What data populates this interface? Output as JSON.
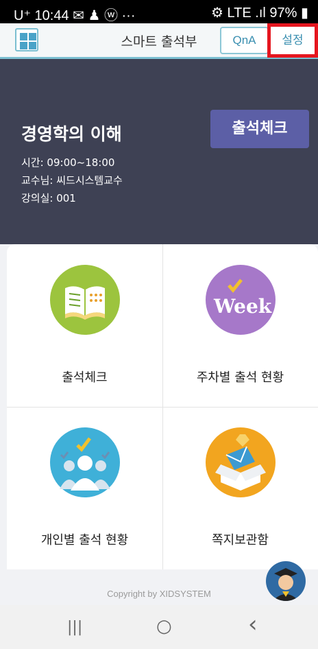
{
  "status_bar": {
    "left": "U⁺ 10:44 ✉ ♟ ⓦ ···",
    "right": "⚙ LTE .ıl 97% ▮"
  },
  "header": {
    "menu_icon": "grid-menu-icon",
    "title": "스마트 출석부",
    "qna_label": "QnA",
    "settings_label": "설정",
    "settings_highlight_color": "#e5161f"
  },
  "banner": {
    "course_name": "경영학의 이해",
    "time": "시간: 09:00~18:00",
    "professor": "교수님: 씨드시스템교수",
    "room": "강의실: 001",
    "check_button": "출석체크"
  },
  "menu": [
    {
      "label": "출석체크",
      "icon": "book-icon",
      "color": "#9cc43e"
    },
    {
      "label": "주차별 출석 현황",
      "icon": "week-icon",
      "color": "#a678c9"
    },
    {
      "label": "개인별 출석 현황",
      "icon": "people-check-icon",
      "color": "#3fb0d8"
    },
    {
      "label": "쪽지보관함",
      "icon": "message-box-icon",
      "color": "#f2a51f"
    }
  ],
  "week_icon_text": "Week",
  "footer": {
    "copyright": "Copyright by XIDSYSTEM"
  },
  "nav": {
    "recents": "|||",
    "home": "○",
    "back": "‹"
  }
}
